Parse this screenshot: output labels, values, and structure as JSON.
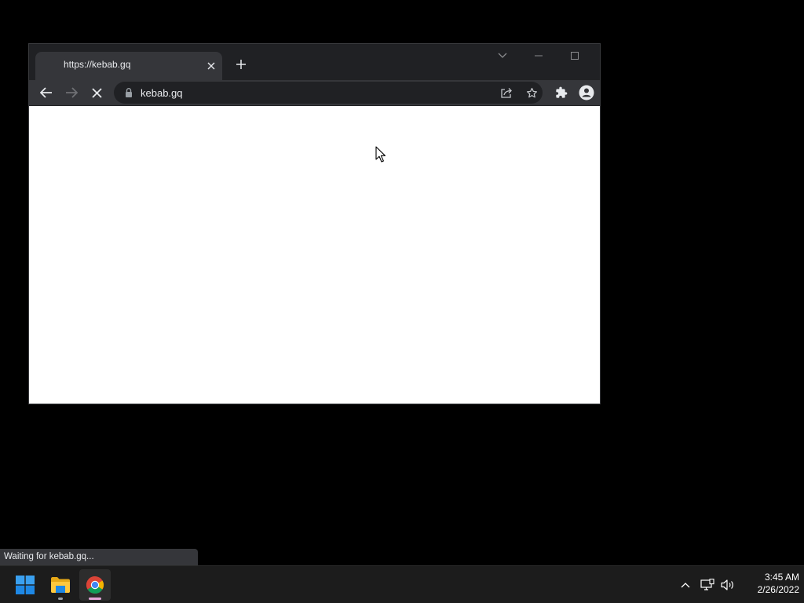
{
  "browser": {
    "tab": {
      "title": "https://kebab.gq",
      "close_icon": "close-icon"
    },
    "new_tab_icon": "plus-icon",
    "window_controls": {
      "tab_search_icon": "chevron-down-icon",
      "minimize_icon": "minimize-icon",
      "maximize_icon": "maximize-icon"
    },
    "toolbar": {
      "back_icon": "arrow-left-icon",
      "forward_icon": "arrow-right-icon",
      "stop_icon": "close-icon",
      "address": {
        "lock_icon": "lock-icon",
        "url": "kebab.gq",
        "share_icon": "share-icon",
        "bookmark_icon": "star-icon"
      },
      "extensions_icon": "puzzle-icon",
      "profile_icon": "person-icon"
    },
    "page": {
      "loading": true
    }
  },
  "status_bubble": {
    "text": "Waiting for kebab.gq..."
  },
  "taskbar": {
    "apps": [
      {
        "name": "Start",
        "icon": "windows-logo-icon"
      },
      {
        "name": "File Explorer",
        "icon": "folder-icon"
      },
      {
        "name": "Google Chrome",
        "icon": "chrome-icon",
        "active": true
      }
    ],
    "tray": {
      "overflow_icon": "chevron-up-icon",
      "network_icon": "network-icon",
      "volume_icon": "volume-icon"
    },
    "clock": {
      "time": "3:45 AM",
      "date": "2/26/2022"
    }
  },
  "colors": {
    "desktop": "#000000",
    "chrome_frame": "#202124",
    "chrome_toolbar": "#35363a",
    "chrome_text": "#e8eaed",
    "taskbar": "#1c1c1c",
    "chrome_indicator": "#e3a6d8",
    "explorer_indicator": "#9aa0a6"
  }
}
